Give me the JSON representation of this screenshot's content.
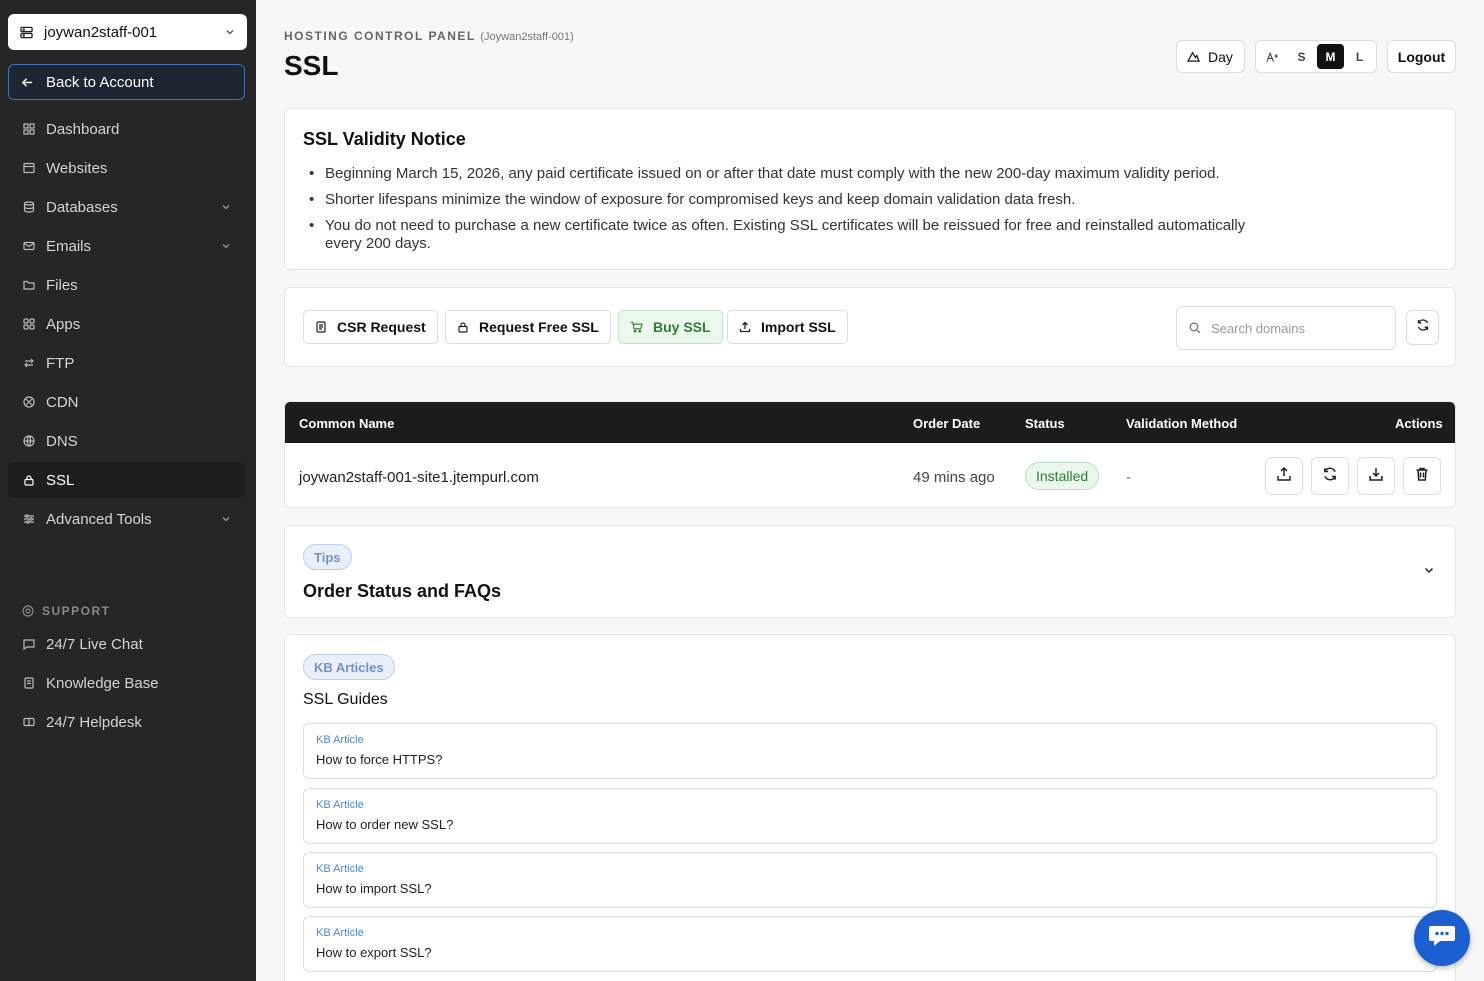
{
  "sidebar": {
    "account": "joywan2staff-001",
    "back_label": "Back to Account",
    "items": [
      {
        "label": "Dashboard",
        "icon": "grid-icon"
      },
      {
        "label": "Websites",
        "icon": "browser-icon"
      },
      {
        "label": "Databases",
        "icon": "database-icon"
      },
      {
        "label": "Emails",
        "icon": "mail-icon"
      },
      {
        "label": "Files",
        "icon": "folder-icon"
      },
      {
        "label": "Apps",
        "icon": "apps-icon"
      },
      {
        "label": "FTP",
        "icon": "transfer-icon"
      },
      {
        "label": "CDN",
        "icon": "network-icon"
      },
      {
        "label": "DNS",
        "icon": "globe-icon"
      },
      {
        "label": "SSL",
        "icon": "lock-icon"
      },
      {
        "label": "Advanced Tools",
        "icon": "sliders-icon"
      }
    ],
    "support_label": "SUPPORT",
    "support_items": [
      {
        "label": "24/7 Live Chat",
        "icon": "chat-icon"
      },
      {
        "label": "Knowledge Base",
        "icon": "book-icon"
      },
      {
        "label": "24/7 Helpdesk",
        "icon": "ticket-icon"
      }
    ]
  },
  "header": {
    "kicker": "HOSTING CONTROL PANEL",
    "kicker_sub": "(Joywan2staff-001)",
    "title": "SSL",
    "theme_label": "Day",
    "sizes": [
      "S",
      "M",
      "L"
    ],
    "selected_size": "M",
    "logout_label": "Logout"
  },
  "notice": {
    "title": "SSL Validity Notice",
    "bullets": [
      "Beginning March 15, 2026, any paid certificate issued on or after that date must comply with the new 200-day maximum validity period.",
      "Shorter lifespans minimize the window of exposure for compromised keys and keep domain validation data fresh.",
      "You do not need to purchase a new certificate twice as often. Existing SSL certificates will be reissued for free and reinstalled automatically every 200 days."
    ]
  },
  "toolbar": {
    "csr_label": "CSR Request",
    "free_label": "Request Free SSL",
    "buy_label": "Buy SSL",
    "import_label": "Import SSL",
    "search_placeholder": "Search domains"
  },
  "table": {
    "headers": [
      "Common Name",
      "Order Date",
      "Status",
      "Validation Method",
      "Actions"
    ],
    "rows": [
      {
        "common_name": "joywan2staff-001-site1.jtempurl.com",
        "order_date": "49 mins ago",
        "status": "Installed",
        "validation": "-"
      }
    ]
  },
  "faq": {
    "tag": "Tips",
    "title": "Order Status and FAQs"
  },
  "kb": {
    "tag": "KB Articles",
    "title": "SSL Guides",
    "items": [
      {
        "tag": "KB Article",
        "question": "How to force HTTPS?"
      },
      {
        "tag": "KB Article",
        "question": "How to order new SSL?"
      },
      {
        "tag": "KB Article",
        "question": "How to import SSL?"
      },
      {
        "tag": "KB Article",
        "question": "How to export SSL?"
      }
    ]
  },
  "colors": {
    "sidebar_bg": "#262626",
    "accent_blue": "#1c5fd1",
    "status_green": "#2e7d32"
  }
}
